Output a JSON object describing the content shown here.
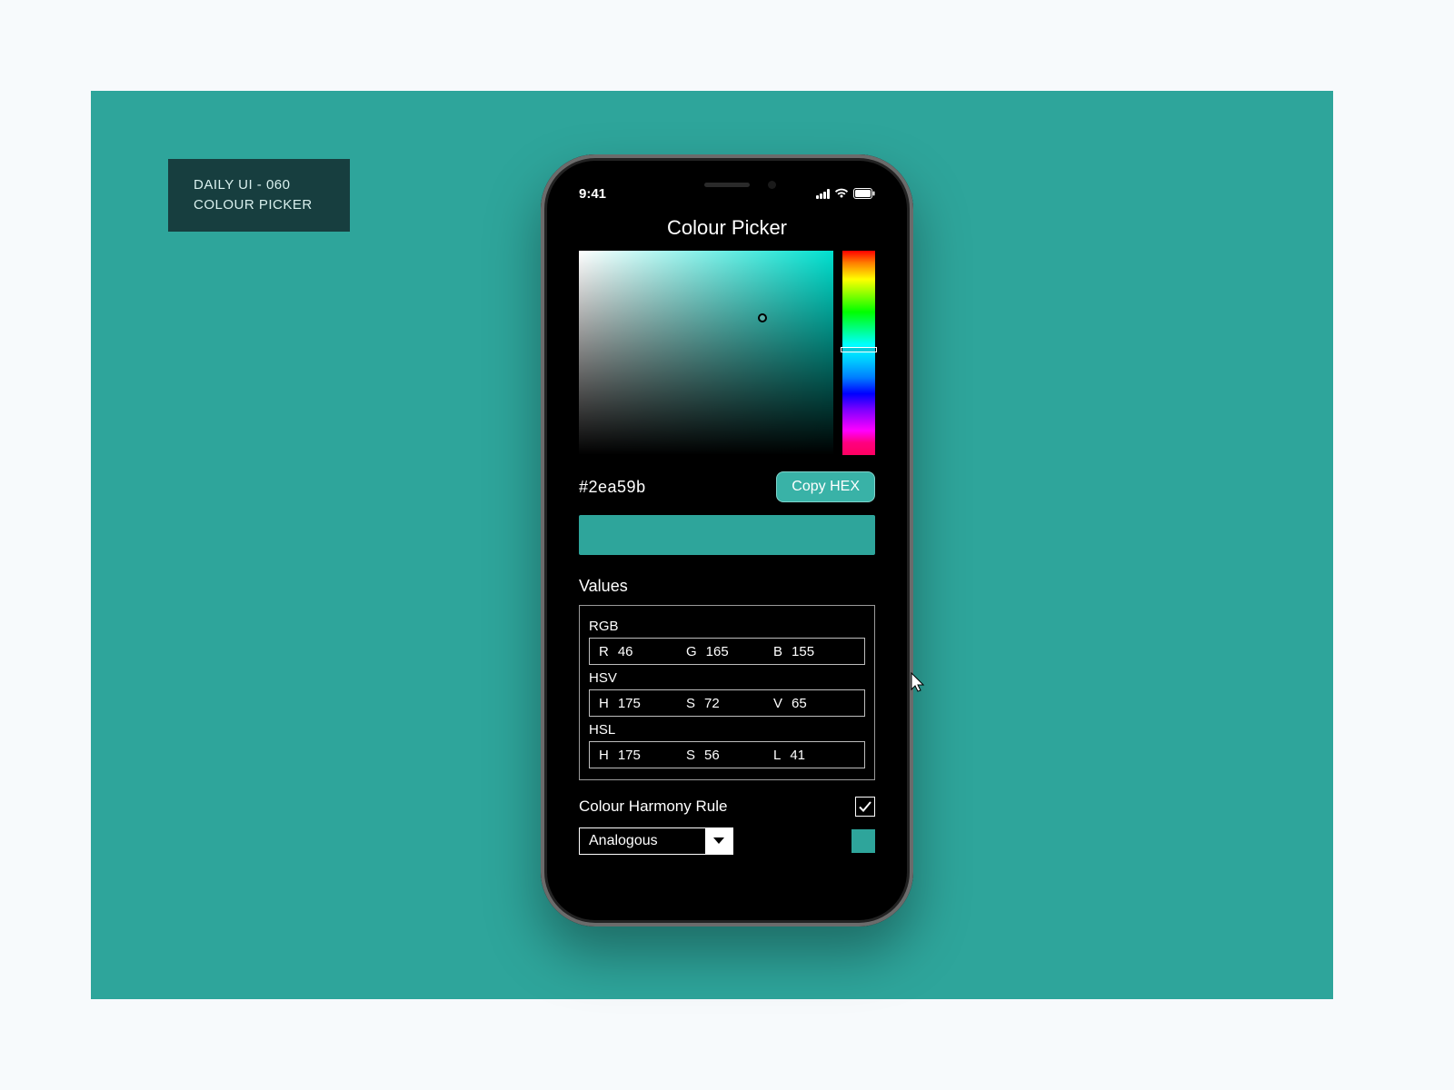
{
  "badge": {
    "line1": "DAILY UI - 060",
    "line2": "COLOUR PICKER"
  },
  "status": {
    "time": "9:41"
  },
  "app": {
    "title": "Colour Picker",
    "hex": "#2ea59b",
    "copy_label": "Copy HEX",
    "swatch_color": "#2ea59b",
    "values_label": "Values",
    "rgb_label": "RGB",
    "rgb": {
      "r_label": "R",
      "r": "46",
      "g_label": "G",
      "g": "165",
      "b_label": "B",
      "b": "155"
    },
    "hsv_label": "HSV",
    "hsv": {
      "h_label": "H",
      "h": "175",
      "s_label": "S",
      "s": "72",
      "v_label": "V",
      "v": "65"
    },
    "hsl_label": "HSL",
    "hsl": {
      "h_label": "H",
      "h": "175",
      "s_label": "S",
      "s": "56",
      "l_label": "L",
      "l": "41"
    },
    "harmony_label": "Colour Harmony Rule",
    "harmony_selected": "Analogous"
  }
}
